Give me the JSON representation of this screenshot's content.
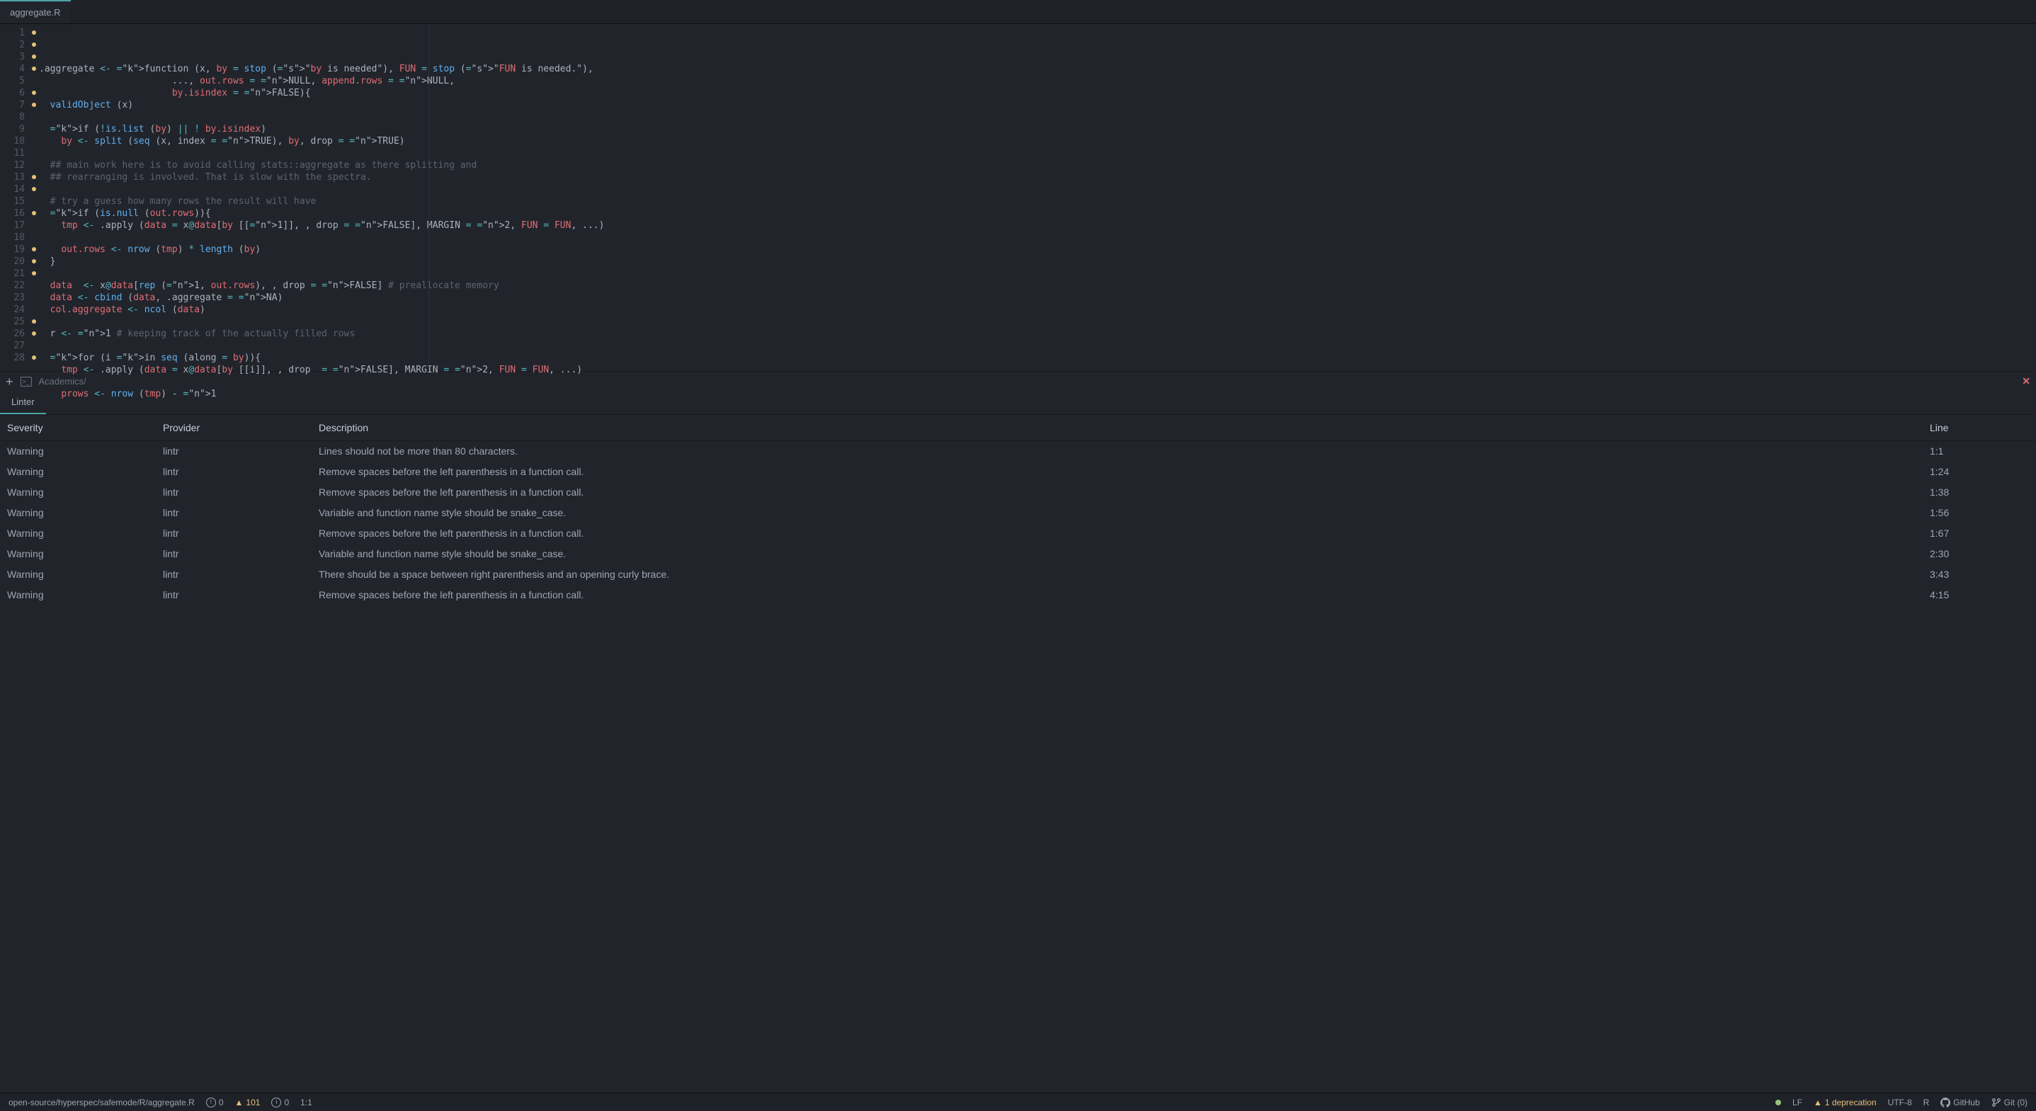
{
  "tab": {
    "title": "aggregate.R"
  },
  "gutter": {
    "lines": 28,
    "dots": [
      1,
      2,
      3,
      4,
      6,
      7,
      13,
      14,
      16,
      19,
      20,
      21,
      25,
      26,
      28
    ]
  },
  "code": [
    {
      "t": "l1"
    },
    {
      "t": "l2"
    },
    {
      "t": "l3"
    },
    {
      "t": "l4"
    },
    {
      "t": "blank"
    },
    {
      "t": "l6"
    },
    {
      "t": "l7"
    },
    {
      "t": "blank"
    },
    {
      "t": "l9"
    },
    {
      "t": "l10"
    },
    {
      "t": "blank"
    },
    {
      "t": "l12"
    },
    {
      "t": "l13"
    },
    {
      "t": "l14"
    },
    {
      "t": "blank"
    },
    {
      "t": "l16"
    },
    {
      "t": "l17"
    },
    {
      "t": "blank"
    },
    {
      "t": "l19"
    },
    {
      "t": "l20"
    },
    {
      "t": "l21"
    },
    {
      "t": "blank"
    },
    {
      "t": "l23"
    },
    {
      "t": "blank"
    },
    {
      "t": "l25"
    },
    {
      "t": "l26"
    },
    {
      "t": "blank"
    },
    {
      "t": "l28"
    }
  ],
  "src": {
    "l1": ".aggregate <- function (x, by = stop (\"by is needed\"), FUN = stop (\"FUN is needed.\"),",
    "l2": "                        ..., out.rows = NULL, append.rows = NULL,",
    "l3": "                        by.isindex = FALSE){",
    "l4": "  validObject (x)",
    "l6": "  if (!is.list (by) || ! by.isindex)",
    "l7": "    by <- split (seq (x, index = TRUE), by, drop = TRUE)",
    "l9": "  ## main work here is to avoid calling stats::aggregate as there splitting and",
    "l10": "  ## rearranging is involved. That is slow with the spectra.",
    "l12": "  # try a guess how many rows the result will have",
    "l13": "  if (is.null (out.rows)){",
    "l14": "    tmp <- .apply (data = x@data[by [[1]], , drop = FALSE], MARGIN = 2, FUN = FUN, ...)",
    "l16": "    out.rows <- nrow (tmp) * length (by)",
    "l17": "  }",
    "l19": "  data  <- x@data[rep (1, out.rows), , drop = FALSE] # preallocate memory",
    "l20": "  data <- cbind (data, .aggregate = NA)",
    "l21": "  col.aggregate <- ncol (data)",
    "l23": "  r <- 1 # keeping track of the actually filled rows",
    "l25": "  for (i in seq (along = by)){",
    "l26": "    tmp <- .apply (data = x@data[by [[i]], , drop  = FALSE], MARGIN = 2, FUN = FUN, ...)",
    "l28": "    prows <- nrow (tmp) - 1"
  },
  "toolstrip": {
    "path": "Academics/"
  },
  "linter": {
    "tab_label": "Linter",
    "headers": {
      "sev": "Severity",
      "prov": "Provider",
      "desc": "Description",
      "line": "Line"
    },
    "rows": [
      {
        "sev": "Warning",
        "prov": "lintr",
        "desc": "Lines should not be more than 80 characters.",
        "line": "1:1"
      },
      {
        "sev": "Warning",
        "prov": "lintr",
        "desc": "Remove spaces before the left parenthesis in a function call.",
        "line": "1:24"
      },
      {
        "sev": "Warning",
        "prov": "lintr",
        "desc": "Remove spaces before the left parenthesis in a function call.",
        "line": "1:38"
      },
      {
        "sev": "Warning",
        "prov": "lintr",
        "desc": "Variable and function name style should be snake_case.",
        "line": "1:56"
      },
      {
        "sev": "Warning",
        "prov": "lintr",
        "desc": "Remove spaces before the left parenthesis in a function call.",
        "line": "1:67"
      },
      {
        "sev": "Warning",
        "prov": "lintr",
        "desc": "Variable and function name style should be snake_case.",
        "line": "2:30"
      },
      {
        "sev": "Warning",
        "prov": "lintr",
        "desc": "There should be a space between right parenthesis and an opening curly brace.",
        "line": "3:43"
      },
      {
        "sev": "Warning",
        "prov": "lintr",
        "desc": "Remove spaces before the left parenthesis in a function call.",
        "line": "4:15"
      }
    ]
  },
  "status": {
    "path": "open-source/hyperspec/safemode/R/aggregate.R",
    "errors": "0",
    "warnings": "101",
    "infos": "0",
    "cursor": "1:1",
    "eol": "LF",
    "deprecation": "1 deprecation",
    "encoding": "UTF-8",
    "lang": "R",
    "github": "GitHub",
    "git": "Git (0)"
  }
}
